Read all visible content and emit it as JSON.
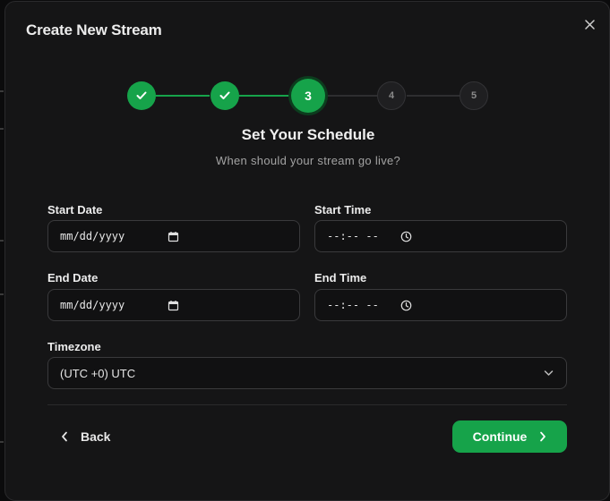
{
  "dialog": {
    "title": "Create New Stream"
  },
  "stepper": {
    "current_step": 3,
    "steps": [
      {
        "label": "",
        "status": "complete",
        "icon": "check-icon"
      },
      {
        "label": "",
        "status": "complete",
        "icon": "check-icon"
      },
      {
        "label": "3",
        "status": "current"
      },
      {
        "label": "4",
        "status": "pending"
      },
      {
        "label": "5",
        "status": "pending"
      }
    ]
  },
  "section": {
    "heading": "Set Your Schedule",
    "subheading": "When should your stream go live?"
  },
  "form": {
    "start_date": {
      "label": "Start Date",
      "value": "mm/dd/yyyy",
      "icon": "calendar-icon"
    },
    "start_time": {
      "label": "Start Time",
      "value": "--:-- --",
      "icon": "clock-icon"
    },
    "end_date": {
      "label": "End Date",
      "value": "mm/dd/yyyy",
      "icon": "calendar-icon"
    },
    "end_time": {
      "label": "End Time",
      "value": "--:-- --",
      "icon": "clock-icon"
    },
    "timezone": {
      "label": "Timezone",
      "value": "(UTC +0) UTC",
      "icon": "chevron-down-icon"
    }
  },
  "footer": {
    "back_label": "Back",
    "continue_label": "Continue"
  },
  "colors": {
    "accent": "#16a34a",
    "background": "#151516",
    "input_border": "#3a3a3c"
  }
}
